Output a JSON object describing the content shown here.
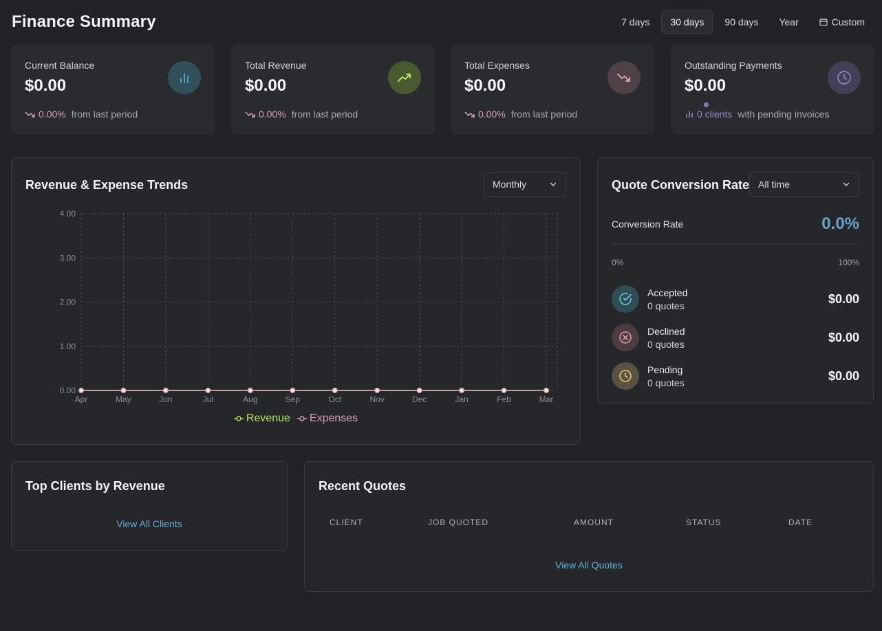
{
  "header": {
    "title": "Finance Summary",
    "ranges": [
      "7 days",
      "30 days",
      "90 days",
      "Year"
    ],
    "active_range": "30 days",
    "custom_label": "Custom"
  },
  "stats": [
    {
      "label": "Current Balance",
      "value": "$0.00",
      "change": "0.00%",
      "suffix": "from last period",
      "icon": "bar-chart-icon",
      "color": "#5fa8c8"
    },
    {
      "label": "Total Revenue",
      "value": "$0.00",
      "change": "0.00%",
      "suffix": "from last period",
      "icon": "trending-up-icon",
      "color": "#b6e35a"
    },
    {
      "label": "Total Expenses",
      "value": "$0.00",
      "change": "0.00%",
      "suffix": "from last period",
      "icon": "trending-down-icon",
      "color": "#d8a3ae"
    },
    {
      "label": "Outstanding Payments",
      "value": "$0.00",
      "clients": "0 clients",
      "suffix": "with pending invoices",
      "icon": "clock-icon",
      "color": "#9a88c9"
    }
  ],
  "trends": {
    "title": "Revenue & Expense Trends",
    "period": "Monthly"
  },
  "chart_data": {
    "type": "line",
    "title": "Revenue & Expense Trends",
    "categories": [
      "Apr",
      "May",
      "Jun",
      "Jul",
      "Aug",
      "Sep",
      "Oct",
      "Nov",
      "Dec",
      "Jan",
      "Feb",
      "Mar"
    ],
    "series": [
      {
        "name": "Revenue",
        "values": [
          0,
          0,
          0,
          0,
          0,
          0,
          0,
          0,
          0,
          0,
          0,
          0
        ],
        "color": "#b6e35a"
      },
      {
        "name": "Expenses",
        "values": [
          0,
          0,
          0,
          0,
          0,
          0,
          0,
          0,
          0,
          0,
          0,
          0
        ],
        "color": "#d8a3ae"
      }
    ],
    "yticks": [
      "0.00",
      "1.00",
      "2.00",
      "3.00",
      "4.00"
    ],
    "ylim": [
      0,
      4
    ],
    "grid": true,
    "legend": "bottom-center"
  },
  "conversion": {
    "title": "Quote Conversion Rate",
    "filter": "All time",
    "label": "Conversion Rate",
    "value": "0.0%",
    "min": "0%",
    "max": "100%",
    "rows": [
      {
        "name": "Accepted",
        "count": "0 quotes",
        "amount": "$0.00",
        "icon": "check-circle-icon",
        "color": "#6fc3d6",
        "bg": "#2f4d55"
      },
      {
        "name": "Declined",
        "count": "0 quotes",
        "amount": "$0.00",
        "icon": "x-circle-icon",
        "color": "#d79aa5",
        "bg": "#4d3d42"
      },
      {
        "name": "Pending",
        "count": "0 quotes",
        "amount": "$0.00",
        "icon": "clock-icon",
        "color": "#e8c76a",
        "bg": "#5a5240"
      }
    ]
  },
  "top_clients": {
    "title": "Top Clients by Revenue",
    "link": "View All Clients"
  },
  "recent_quotes": {
    "title": "Recent Quotes",
    "columns": [
      "CLIENT",
      "JOB QUOTED",
      "AMOUNT",
      "STATUS",
      "DATE"
    ],
    "link": "View All Quotes"
  }
}
